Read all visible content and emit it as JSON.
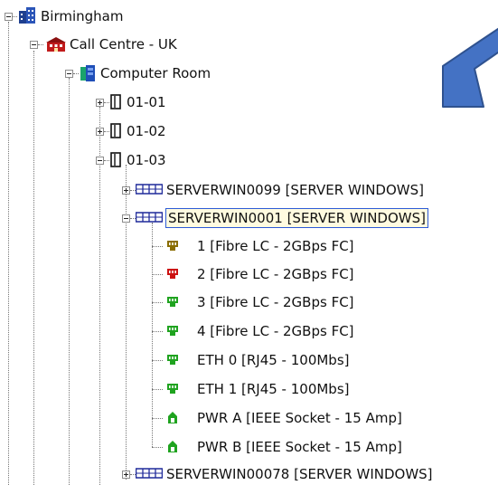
{
  "tree": {
    "root": {
      "label": "Birmingham",
      "icon": "building-icon"
    },
    "site": {
      "label": "Call Centre - UK",
      "icon": "red-building-icon"
    },
    "room": {
      "label": "Computer Room",
      "icon": "room-icon"
    },
    "racks": [
      {
        "label": "01-01",
        "icon": "rack-icon",
        "expanded": false
      },
      {
        "label": "01-02",
        "icon": "rack-icon",
        "expanded": false
      },
      {
        "label": "01-03",
        "icon": "rack-icon",
        "expanded": true
      }
    ],
    "servers": [
      {
        "label": "SERVERWIN0099 [SERVER WINDOWS]",
        "icon": "server-icon",
        "expanded": false
      },
      {
        "label": "SERVERWIN0001 [SERVER WINDOWS]",
        "icon": "server-icon",
        "expanded": true,
        "selected": true
      },
      {
        "label": "SERVERWIN00078 [SERVER WINDOWS]",
        "icon": "server-icon",
        "expanded": false
      }
    ],
    "ports": [
      {
        "label": "1 [Fibre LC - 2GBps FC]",
        "icon": "port-icon",
        "color": "#8a6d00"
      },
      {
        "label": "2 [Fibre LC - 2GBps FC]",
        "icon": "port-icon",
        "color": "#cc1111"
      },
      {
        "label": "3 [Fibre LC - 2GBps FC]",
        "icon": "port-icon",
        "color": "#1fa31f"
      },
      {
        "label": "4 [Fibre LC - 2GBps FC]",
        "icon": "port-icon",
        "color": "#1fa31f"
      },
      {
        "label": "ETH 0 [RJ45 - 100Mbs]",
        "icon": "port-icon",
        "color": "#1fa31f"
      },
      {
        "label": "ETH 1 [RJ45 - 100Mbs]",
        "icon": "port-icon",
        "color": "#1fa31f"
      },
      {
        "label": "PWR A [IEEE Socket - 15 Amp]",
        "icon": "power-socket-icon",
        "color": "#1fa31f"
      },
      {
        "label": "PWR B [IEEE Socket - 15 Amp]",
        "icon": "power-socket-icon",
        "color": "#1fa31f"
      }
    ]
  },
  "annotation": {
    "icon": "arrow-pointer-icon",
    "color": "#4472c4",
    "border": "#2f528f"
  }
}
